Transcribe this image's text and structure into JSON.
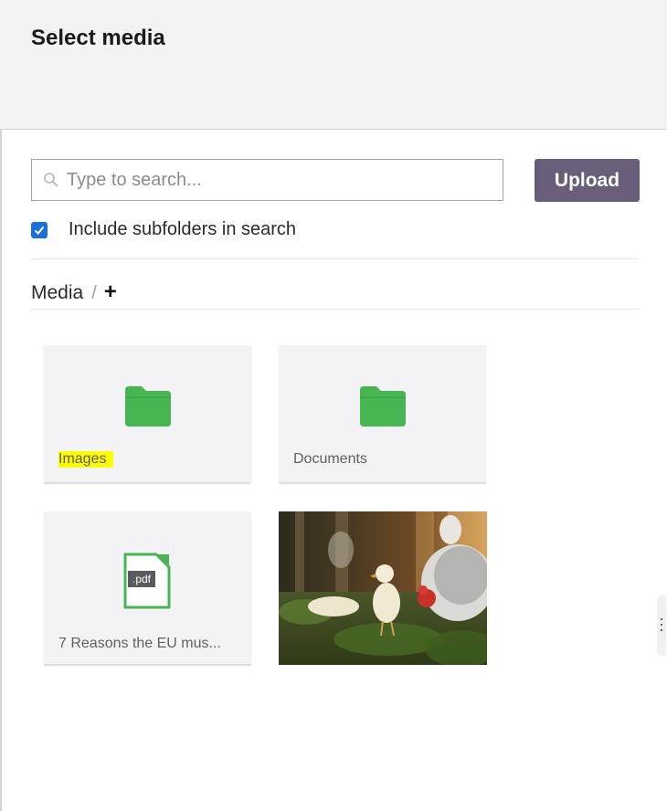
{
  "header": {
    "title": "Select media"
  },
  "search": {
    "placeholder": "Type to search...",
    "value": ""
  },
  "toolbar": {
    "upload_label": "Upload"
  },
  "filters": {
    "include_subfolders_label": "Include subfolders in search",
    "include_subfolders_checked": true
  },
  "breadcrumb": {
    "root": "Media",
    "separator": "/",
    "add_label": "+"
  },
  "items": [
    {
      "type": "folder",
      "name": "Images",
      "icon": "folder-icon",
      "highlighted": true
    },
    {
      "type": "folder",
      "name": "Documents",
      "icon": "folder-icon",
      "highlighted": false
    },
    {
      "type": "file",
      "name": "7 Reasons the EU mus...",
      "icon": "pdf-file-icon",
      "badge": ".pdf"
    },
    {
      "type": "image",
      "name": "",
      "icon": "image-thumbnail"
    }
  ],
  "colors": {
    "accent": "#685e7a",
    "folder": "#47b551",
    "checkbox": "#1b6fd6",
    "highlight": "#fcff00",
    "header_bg": "#f3f3f5",
    "tile_bg": "#f3f3f5"
  }
}
